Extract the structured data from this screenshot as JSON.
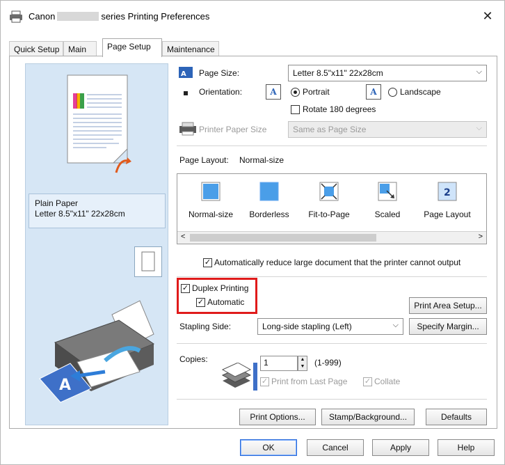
{
  "window": {
    "title_prefix": "Canon",
    "title_suffix": "series Printing Preferences",
    "close_glyph": "✕"
  },
  "tabs": [
    {
      "label": "Quick Setup"
    },
    {
      "label": "Main"
    },
    {
      "label": "Page Setup"
    },
    {
      "label": "Maintenance"
    }
  ],
  "preview": {
    "media_type": "Plain Paper",
    "paper_size": "Letter 8.5\"x11\" 22x28cm"
  },
  "page_size": {
    "label": "Page Size:",
    "value": "Letter 8.5\"x11\" 22x28cm"
  },
  "orientation": {
    "label": "Orientation:",
    "portrait": "Portrait",
    "landscape": "Landscape",
    "rotate": "Rotate 180 degrees",
    "icon_glyph": "A"
  },
  "printer_paper_size": {
    "label": "Printer Paper Size",
    "value": "Same as Page Size"
  },
  "page_layout": {
    "label": "Page Layout:",
    "current": "Normal-size",
    "items": [
      {
        "label": "Normal-size"
      },
      {
        "label": "Borderless"
      },
      {
        "label": "Fit-to-Page"
      },
      {
        "label": "Scaled"
      },
      {
        "label": "Page Layout"
      }
    ],
    "page_layout_icon_text": "2",
    "scroll_left": "<",
    "scroll_right": ">"
  },
  "auto_reduce": {
    "label": "Automatically reduce large document that the printer cannot output",
    "checked": true
  },
  "duplex": {
    "label": "Duplex Printing",
    "automatic": "Automatic",
    "highlight_color": "#e01b1b"
  },
  "print_area_setup": "Print Area Setup...",
  "stapling": {
    "label": "Stapling Side:",
    "value": "Long-side stapling (Left)"
  },
  "specify_margin": "Specify Margin...",
  "copies": {
    "label": "Copies:",
    "value": "1",
    "range": "(1-999)",
    "last_page": "Print from Last Page",
    "collate": "Collate"
  },
  "bottom_buttons": {
    "print_options": "Print Options...",
    "stamp": "Stamp/Background...",
    "defaults": "Defaults"
  },
  "dialog_buttons": {
    "ok": "OK",
    "cancel": "Cancel",
    "apply": "Apply",
    "help": "Help"
  },
  "check_glyph": "✓",
  "colors": {
    "preview_bg": "#d6e6f5",
    "accent": "#2a6ad8",
    "icon_blue": "#4a9ee8"
  }
}
